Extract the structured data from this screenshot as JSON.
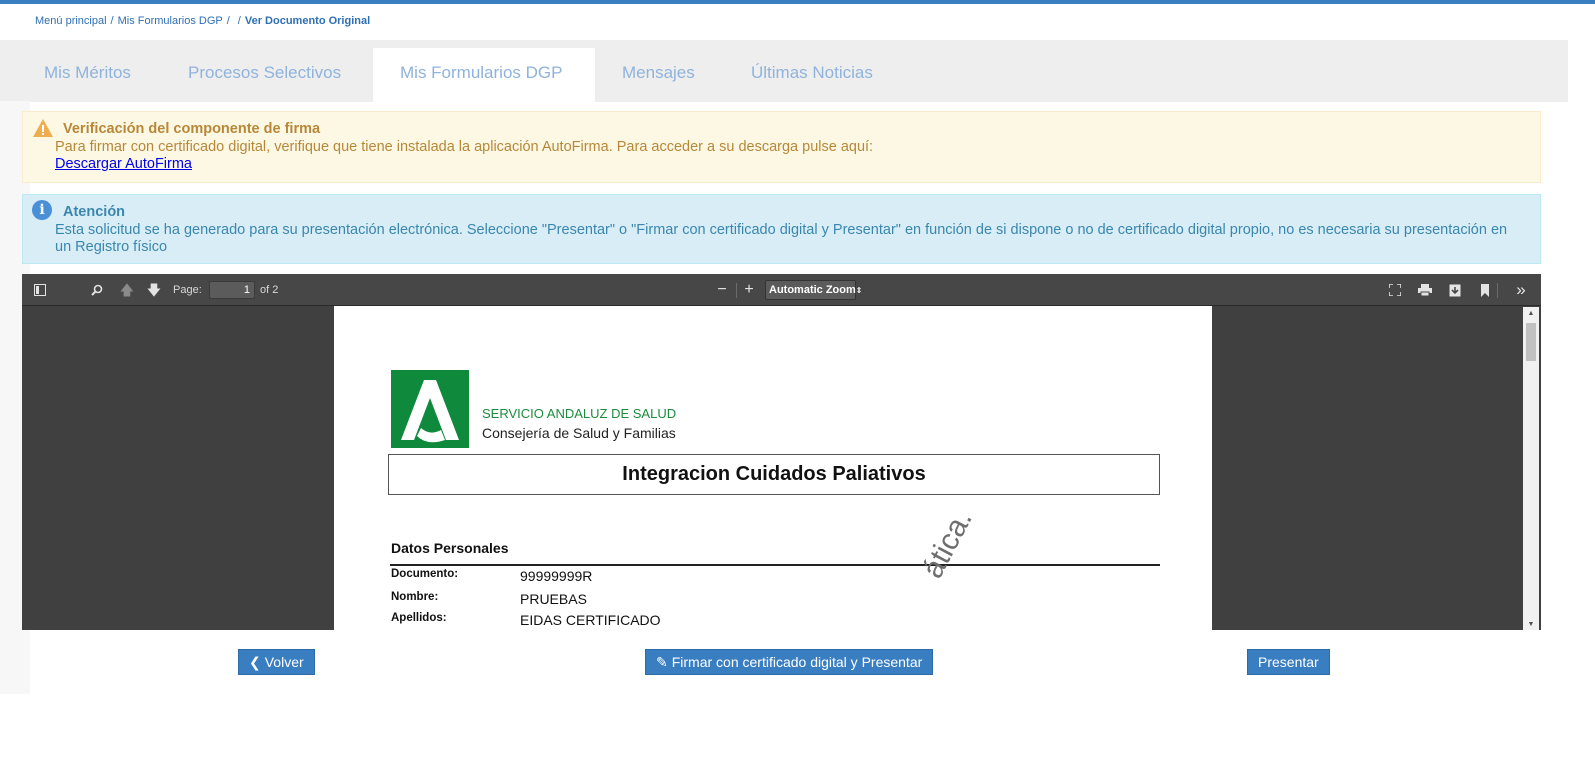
{
  "breadcrumb": {
    "items": [
      "Menú principal",
      "Mis Formularios DGP",
      "",
      "Ver Documento Original"
    ]
  },
  "tabs": [
    {
      "label": "Mis Méritos"
    },
    {
      "label": "Procesos Selectivos"
    },
    {
      "label": "Mis Formularios DGP",
      "active": true
    },
    {
      "label": "Mensajes"
    },
    {
      "label": "Últimas Noticias"
    }
  ],
  "alerts": {
    "warning": {
      "title": "Verificación del componente de firma",
      "body": "Para firmar con certificado digital, verifique que tiene instalada la aplicación AutoFirma. Para acceder a su descarga pulse aquí:",
      "link": "Descargar AutoFirma"
    },
    "info": {
      "title": "Atención",
      "body": "Esta solicitud se ha generado para su presentación electrónica. Seleccione \"Presentar\" o \"Firmar con certificado digital y Presentar\" en función de si dispone o no de certificado digital propio, no es necesaria su presentación en un Registro físico"
    }
  },
  "viewer": {
    "page_label": "Page:",
    "page_number": "1",
    "page_total": "of 2",
    "zoom": "Automatic Zoom"
  },
  "document": {
    "org_line1": "SERVICIO ANDALUZ DE SALUD",
    "org_line2": "Consejería de Salud y Familias",
    "title": "Integracion Cuidados Paliativos",
    "section": "Datos Personales",
    "fields": [
      {
        "label": "Documento:",
        "value": "99999999R"
      },
      {
        "label": "Nombre:",
        "value": "PRUEBAS"
      },
      {
        "label": "Apellidos:",
        "value": "EIDAS CERTIFICADO"
      }
    ],
    "watermark": "ática."
  },
  "buttons": {
    "back": "Volver",
    "sign": "Firmar con certificado digital y Presentar",
    "submit": "Presentar"
  },
  "colors": {
    "primary": "#3a7ec2",
    "warning_bg": "#fcf8e3",
    "info_bg": "#d9edf7",
    "logo_green": "#0f8a3c"
  }
}
